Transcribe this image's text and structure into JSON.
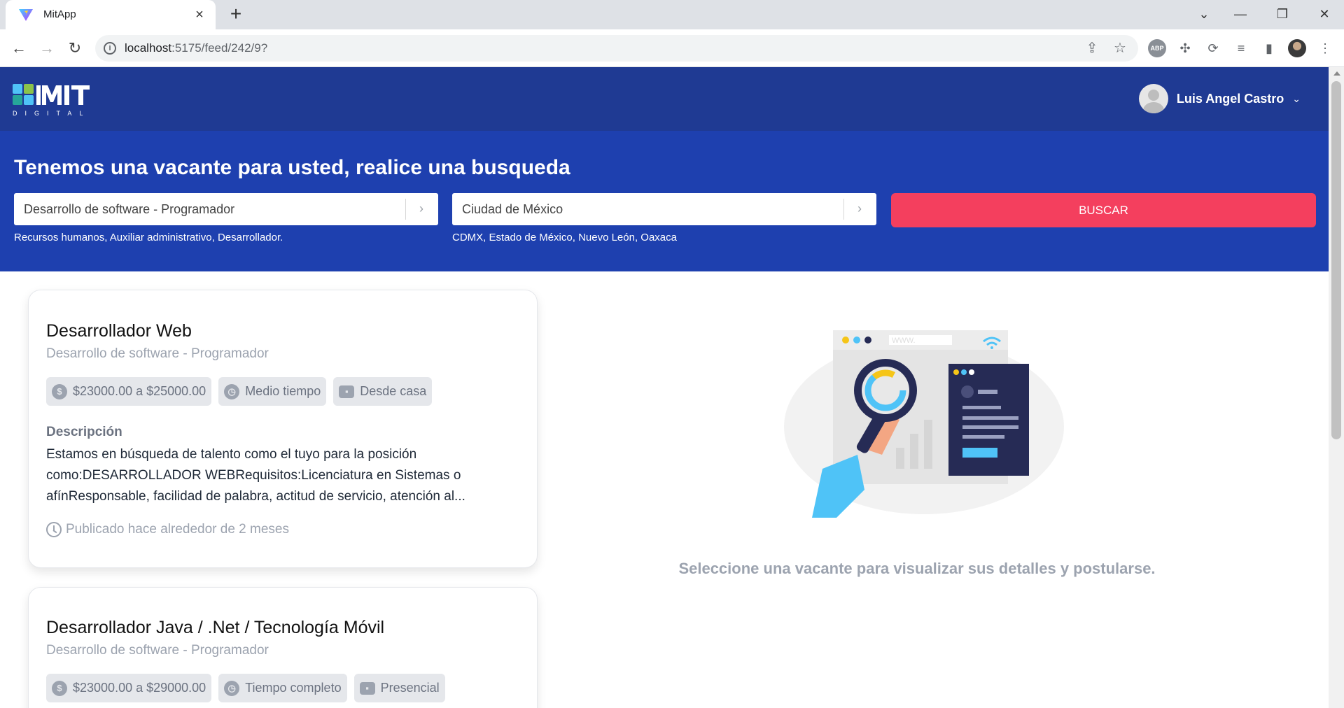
{
  "browser": {
    "tab_title": "MitApp",
    "url_host": "localhost",
    "url_rest": ":5175/feed/242/9?"
  },
  "header": {
    "logo_text": "MIT",
    "logo_sub": "DIGITAL",
    "user_name": "Luis Angel Castro"
  },
  "search": {
    "title": "Tenemos una vacante para usted, realice una busqueda",
    "job_value": "Desarrollo de software - Programador",
    "job_hint": "Recursos humanos, Auxiliar administrativo, Desarrollador.",
    "location_value": "Ciudad de México",
    "location_hint": "CDMX, Estado de México, Nuevo León, Oaxaca",
    "button_label": "BUSCAR"
  },
  "jobs": [
    {
      "title": "Desarrollador Web",
      "category": "Desarrollo de software - Programador",
      "salary": "$23000.00 a $25000.00",
      "schedule": "Medio tiempo",
      "modality": "Desde casa",
      "description_label": "Descripción",
      "description": "Estamos en búsqueda de talento como el tuyo para la posición como:DESARROLLADOR WEBRequisitos:Licenciatura en Sistemas o afínResponsable, facilidad de palabra, actitud de servicio, atención al...",
      "posted": "Publicado hace alrededor de 2 meses"
    },
    {
      "title": "Desarrollador Java / .Net / Tecnología Móvil",
      "category": "Desarrollo de software - Programador",
      "salary": "$23000.00 a $29000.00",
      "schedule": "Tiempo completo",
      "modality": "Presencial"
    }
  ],
  "detail_panel": {
    "empty_message": "Seleccione una vacante para visualizar sus detalles y postularse.",
    "illustration_text": "WWW."
  },
  "colors": {
    "header_bg": "#1f3a93",
    "search_bg": "#1e40af",
    "button_bg": "#f43f5e",
    "chip_bg": "#e5e7eb"
  }
}
